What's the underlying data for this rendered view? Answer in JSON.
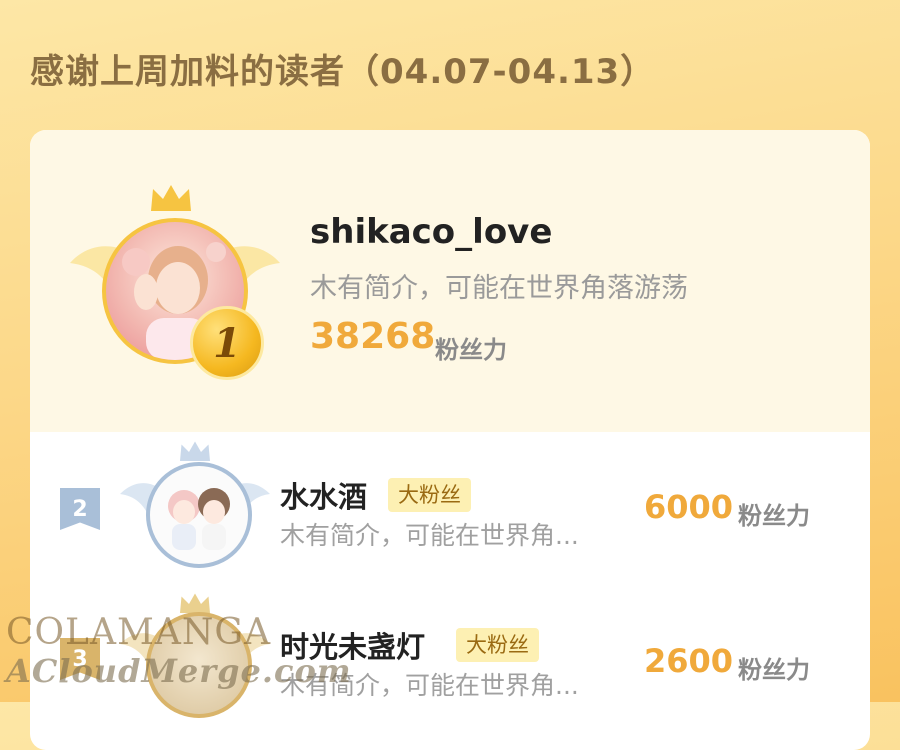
{
  "page": {
    "title": "感谢上周加料的读者（04.07-04.13）"
  },
  "leaderboard": [
    {
      "rank": "1",
      "name": "shikaco_love",
      "bio": "木有简介，可能在世界角落游荡",
      "score": "38268",
      "unit": "粉丝力"
    },
    {
      "rank": "2",
      "name": "水水酒",
      "badge": "大粉丝",
      "bio": "木有简介，可能在世界角...",
      "score": "6000",
      "unit": "粉丝力"
    },
    {
      "rank": "3",
      "name": "时光未盏灯",
      "badge": "大粉丝",
      "bio": "木有简介，可能在世界角...",
      "score": "2600",
      "unit": "粉丝力"
    }
  ],
  "watermark": {
    "line1": "COLAMANGA",
    "line2": "ACloudMerge.com"
  },
  "colors": {
    "accent_score": "#f0a93b",
    "gold": "#f6c441",
    "silver": "#a9bfd8",
    "bronze": "#d9b46a"
  },
  "icons": {
    "crown": "crown-icon",
    "wings": "wings-icon",
    "medal": "rank-medal-icon"
  }
}
